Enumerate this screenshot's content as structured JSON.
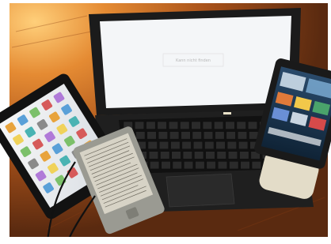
{
  "photo": {
    "subject": "Laptop, tablets and e-reader on a wooden table"
  },
  "laptop": {
    "screen_text": "Kann nicht finden"
  },
  "colors": {
    "table_warm": "#c76a1e",
    "table_dark": "#6a2c08",
    "device_black": "#141414",
    "ereader_body": "#9a9a92",
    "ereader_screen": "#d7d3c6",
    "laptop_screen": "#f4f6f8"
  }
}
